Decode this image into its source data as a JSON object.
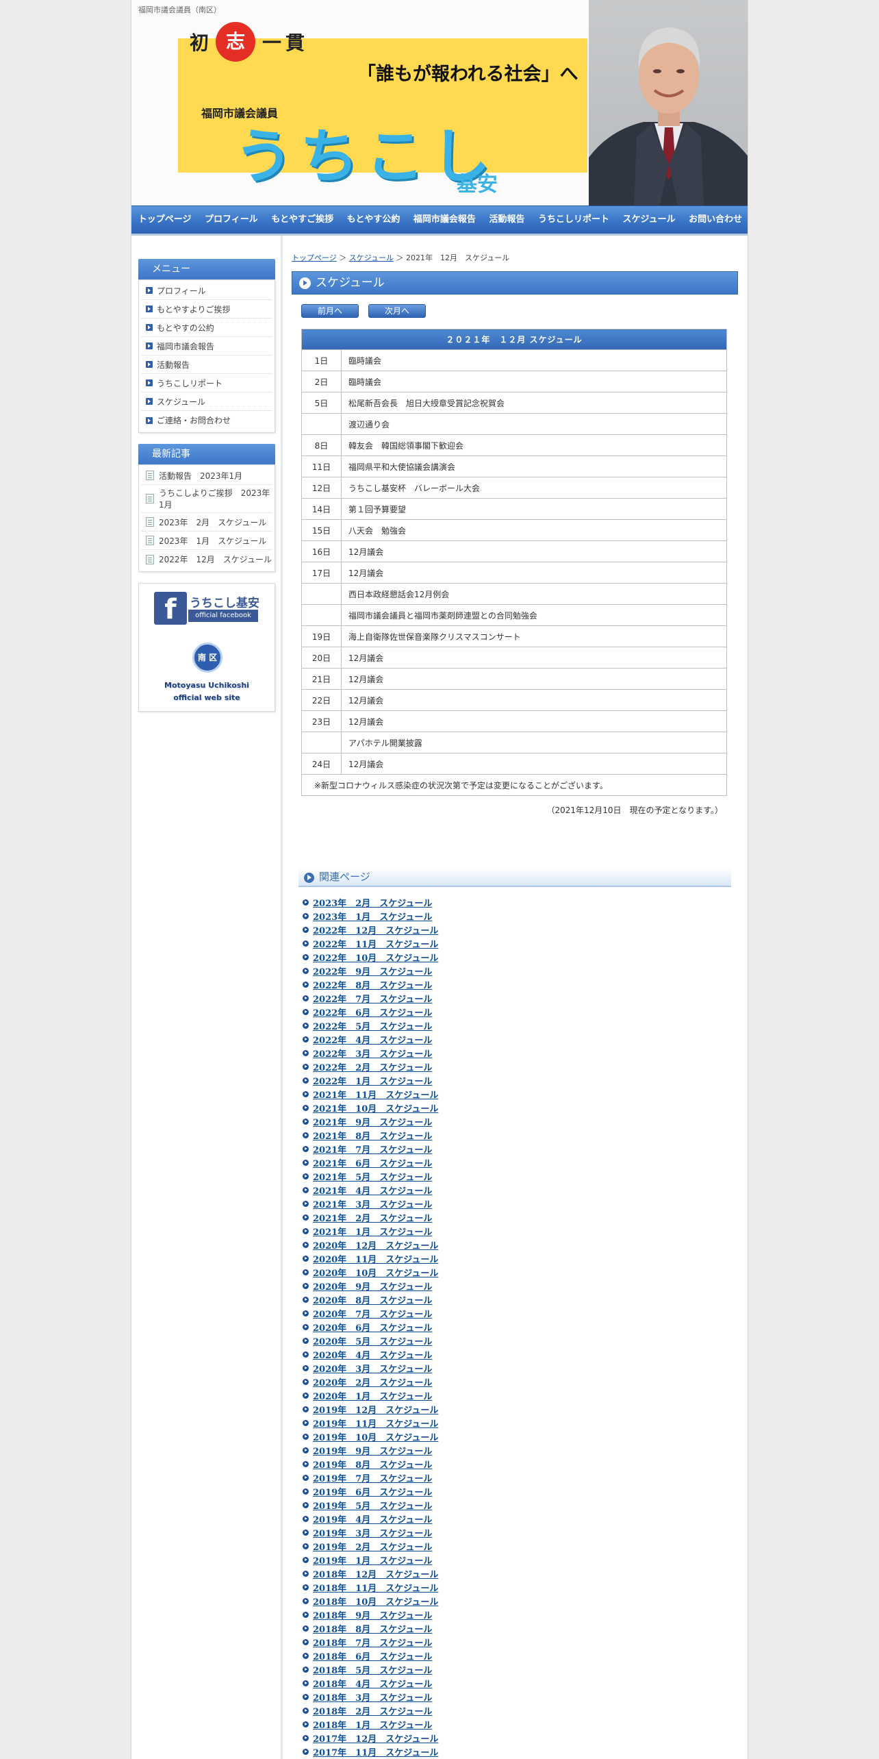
{
  "header": {
    "site_description": "福岡市議会議員（南区）",
    "slogan_chars": [
      "初",
      "志",
      "一",
      "貫"
    ],
    "slogan_main": "「誰もが報われる社会」へ",
    "title_small": "福岡市議会議員",
    "title_name": "うちこし",
    "title_given": "基安"
  },
  "nav": [
    "トップページ",
    "プロフィール",
    "もとやすご挨拶",
    "もとやす公約",
    "福岡市議会報告",
    "活動報告",
    "うちこしリポート",
    "スケジュール",
    "お問い合わせ"
  ],
  "sidebar": {
    "menu_title": "メニュー",
    "menu": [
      "プロフィール",
      "もとやすよりご挨拶",
      "もとやすの公約",
      "福岡市議会報告",
      "活動報告",
      "うちこしリポート",
      "スケジュール",
      "ご連絡・お問合わせ"
    ],
    "recent_title": "最新記事",
    "recent": [
      "活動報告　2023年1月",
      "うちこしよりご挨拶　2023年1月",
      "2023年　2月　スケジュール",
      "2023年　1月　スケジュール",
      "2022年　12月　スケジュール"
    ],
    "banner": {
      "fb_letter": "f",
      "fb_name": "うちこし基安",
      "fb_sub": "official facebook",
      "badge": "南 区",
      "site_line1": "Motoyasu Uchikoshi",
      "site_line2": "official web site"
    }
  },
  "breadcrumb": {
    "home": "トップページ",
    "sep1": "＞",
    "section": "スケジュール",
    "sep2": "＞",
    "current": "2021年　12月　スケジュール"
  },
  "page_heading": "スケジュール",
  "pager": {
    "prev": "前月へ",
    "next": "次月へ"
  },
  "schedule": {
    "title": "２０２１年　１２月 スケジュール",
    "rows": [
      {
        "day": "1日",
        "event": "臨時議会"
      },
      {
        "day": "2日",
        "event": "臨時議会"
      },
      {
        "day": "5日",
        "event": "松尾新吾会長　旭日大綬章受賞記念祝賀会"
      },
      {
        "day": "",
        "event": "渡辺通り会"
      },
      {
        "day": "8日",
        "event": "韓友会　韓国総領事閣下歓迎会"
      },
      {
        "day": "11日",
        "event": "福岡県平和大使協議会講演会"
      },
      {
        "day": "12日",
        "event": "うちこし基安杯　バレーボール大会"
      },
      {
        "day": "14日",
        "event": "第１回予算要望"
      },
      {
        "day": "15日",
        "event": "八天会　勉強会"
      },
      {
        "day": "16日",
        "event": "12月議会"
      },
      {
        "day": "17日",
        "event": "12月議会"
      },
      {
        "day": "",
        "event": "西日本政経懇話会12月例会"
      },
      {
        "day": "",
        "event": "福岡市議会議員と福岡市薬剤師連盟との合同勉強会"
      },
      {
        "day": "19日",
        "event": "海上自衛隊佐世保音楽隊クリスマスコンサート"
      },
      {
        "day": "20日",
        "event": "12月議会"
      },
      {
        "day": "21日",
        "event": "12月議会"
      },
      {
        "day": "22日",
        "event": "12月議会"
      },
      {
        "day": "23日",
        "event": "12月議会"
      },
      {
        "day": "",
        "event": "アパホテル開業披露"
      },
      {
        "day": "24日",
        "event": "12月議会"
      }
    ],
    "note": "※新型コロナウィルス感染症の状況次第で予定は変更になることがございます。",
    "as_of": "（2021年12月10日　現在の予定となります。）"
  },
  "related": {
    "title": "関連ページ",
    "links": [
      "2023年　2月　スケジュール",
      "2023年　1月　スケジュール",
      "2022年　12月　スケジュール",
      "2022年　11月　スケジュール",
      "2022年　10月　スケジュール",
      "2022年　9月　スケジュール",
      "2022年　8月　スケジュール",
      "2022年　7月　スケジュール",
      "2022年　6月　スケジュール",
      "2022年　5月　スケジュール",
      "2022年　4月　スケジュール",
      "2022年　3月　スケジュール",
      "2022年　2月　スケジュール",
      "2022年　1月　スケジュール",
      "2021年　11月　スケジュール",
      "2021年　10月　スケジュール",
      "2021年　9月　スケジュール",
      "2021年　8月　スケジュール",
      "2021年　7月　スケジュール",
      "2021年　6月　スケジュール",
      "2021年　5月　スケジュール",
      "2021年　4月　スケジュール",
      "2021年　3月　スケジュール",
      "2021年　2月　スケジュール",
      "2021年　1月　スケジュール",
      "2020年　12月　スケジュール",
      "2020年　11月　スケジュール",
      "2020年　10月　スケジュール",
      "2020年　9月　スケジュール",
      "2020年　8月　スケジュール",
      "2020年　7月　スケジュール",
      "2020年　6月　スケジュール",
      "2020年　5月　スケジュール",
      "2020年　4月　スケジュール",
      "2020年　3月　スケジュール",
      "2020年　2月　スケジュール",
      "2020年　1月　スケジュール",
      "2019年　12月　スケジュール",
      "2019年　11月　スケジュール",
      "2019年　10月　スケジュール",
      "2019年　9月　スケジュール",
      "2019年　8月　スケジュール",
      "2019年　7月　スケジュール",
      "2019年　6月　スケジュール",
      "2019年　5月　スケジュール",
      "2019年　4月　スケジュール",
      "2019年　3月　スケジュール",
      "2019年　2月　スケジュール",
      "2019年　1月　スケジュール",
      "2018年　12月　スケジュール",
      "2018年　11月　スケジュール",
      "2018年　10月　スケジュール",
      "2018年　9月　スケジュール",
      "2018年　8月　スケジュール",
      "2018年　7月　スケジュール",
      "2018年　6月　スケジュール",
      "2018年　5月　スケジュール",
      "2018年　4月　スケジュール",
      "2018年　3月　スケジュール",
      "2018年　2月　スケジュール",
      "2018年　1月　スケジュール",
      "2017年　12月　スケジュール",
      "2017年　11月　スケジュール"
    ]
  },
  "colors": {
    "nav_blue": "#3a75c7",
    "slogan_yellow": "#ffd94f",
    "name_blue": "#3ab2e5",
    "accent_red": "#e52f26"
  }
}
